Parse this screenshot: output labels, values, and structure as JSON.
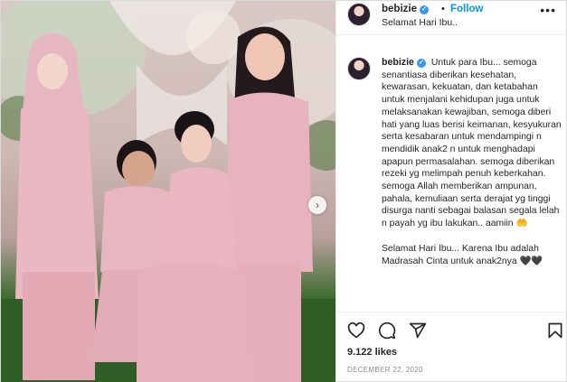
{
  "header": {
    "username": "bebizie",
    "separator": "•",
    "follow_label": "Follow",
    "location": "Selamat Hari Ibu..",
    "more_label": "•••"
  },
  "post": {
    "next_label": "›",
    "caption_username": "bebizie",
    "caption_text": "Untuk para Ibu... semoga senantiasa diberikan kesehatan, kewarasan, kekuatan, dan ketabahan untuk menjalani kehidupan juga untuk melaksanakan kewajiban, semoga diberi hati yang luas berisi keimanan, kesyukuran serta kesabaran untuk mendampingi n mendidik anak2 n untuk menghadapi apapun permasalahan. semoga diberikan rezeki yg melimpah penuh keberkahan. semoga Allah memberikan ampunan, pahala, kemuliaan serta derajat yg tinggi disurga nanti sebagai balasan segala lelah n payah yg ibu lakukan.. aamiin",
    "caption_emoji": "🤲",
    "caption_tail": "Selamat Hari Ibu... Karena Ibu adalah Madrasah Cinta untuk anak2nya 🖤🖤"
  },
  "stats": {
    "likes": "9.122 likes",
    "date": "DECEMBER 22, 2020"
  },
  "icons": {
    "like": "heart-icon",
    "comment": "comment-icon",
    "share": "share-icon",
    "save": "bookmark-icon"
  },
  "colors": {
    "follow": "#0095f6",
    "verified": "#3897f0",
    "outfit_pink": "#e8b9c2"
  }
}
